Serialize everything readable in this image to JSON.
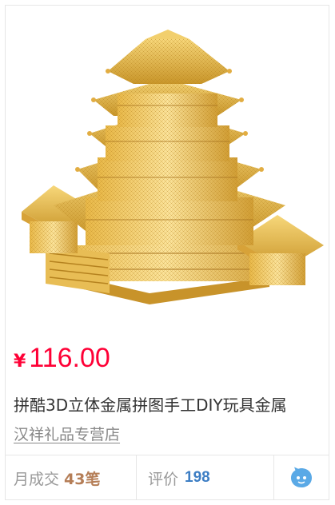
{
  "product": {
    "image_alt": "金属拼图楼阁模型",
    "price_currency": "¥",
    "price_value": "116.00",
    "title": "拼酷3D立体金属拼图手工DIY玩具金属",
    "shop_name": "汉祥礼品专营店"
  },
  "footer": {
    "sales_label": "月成交",
    "sales_value": "43笔",
    "reviews_label": "评价",
    "reviews_value": "198",
    "chat_icon": "wangwang-chat-icon"
  },
  "colors": {
    "price": "#ff0036",
    "sales_value": "#b57e57",
    "reviews_value": "#3d7ec4",
    "chat_icon": "#5aa9e6"
  }
}
